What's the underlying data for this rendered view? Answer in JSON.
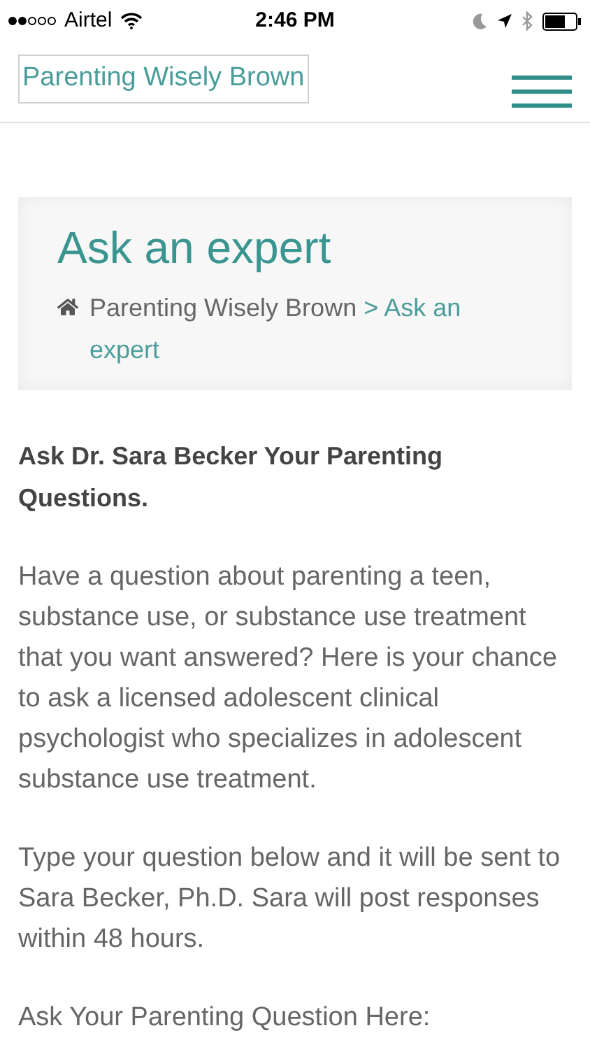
{
  "status_bar": {
    "carrier": "Airtel",
    "time": "2:46 PM"
  },
  "header": {
    "logo": "Parenting Wisely Brown"
  },
  "page_header": {
    "title": "Ask an expert",
    "breadcrumb": {
      "trail": "Parenting Wisely Brown",
      "current": "> Ask an expert"
    }
  },
  "content": {
    "heading": "Ask Dr. Sara Becker Your Parenting Questions.",
    "paragraphs": [
      "Have a question about parenting a teen, substance use, or substance use treatment that you want answered? Here is your chance to ask a licensed adolescent clinical psychologist who specializes in adolescent substance use treatment.",
      "Type your question below and it will be sent to Sara Becker, Ph.D. Sara will post responses within 48 hours.",
      "Ask Your Parenting Question Here:"
    ]
  }
}
